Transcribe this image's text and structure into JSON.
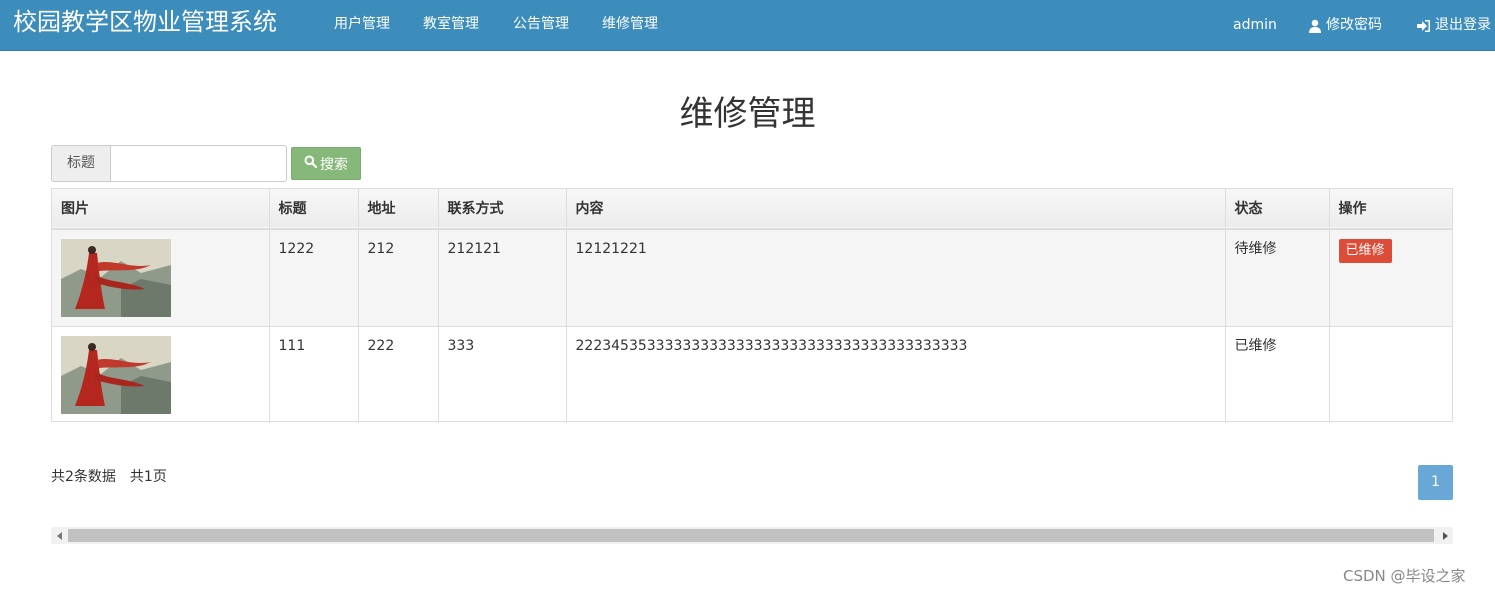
{
  "app": {
    "brand": "校园教学区物业管理系统"
  },
  "nav": {
    "items": [
      {
        "label": "用户管理"
      },
      {
        "label": "教室管理"
      },
      {
        "label": "公告管理"
      },
      {
        "label": "维修管理"
      }
    ],
    "user": "admin",
    "change_password": "修改密码",
    "logout": "退出登录"
  },
  "page": {
    "title": "维修管理"
  },
  "search": {
    "label": "标题",
    "value": "",
    "button": "搜索"
  },
  "table": {
    "headers": [
      "图片",
      "标题",
      "地址",
      "联系方式",
      "内容",
      "状态",
      "操作"
    ],
    "rows": [
      {
        "title": "1222",
        "address": "212",
        "contact": "212121",
        "content": "12121221",
        "status": "待维修",
        "action": "已维修"
      },
      {
        "title": "111",
        "address": "222",
        "contact": "333",
        "content": "22234535333333333333333333333333333333333333",
        "status": "已维修",
        "action": ""
      }
    ]
  },
  "pager": {
    "total": "共2条数据",
    "pages": "共1页",
    "current": "1"
  },
  "colors": {
    "navbar": "#3c8dbc",
    "search_button": "#86b87a",
    "action_button": "#dd4b39",
    "active_page": "#69a8d6"
  },
  "watermark": "CSDN @毕设之家"
}
